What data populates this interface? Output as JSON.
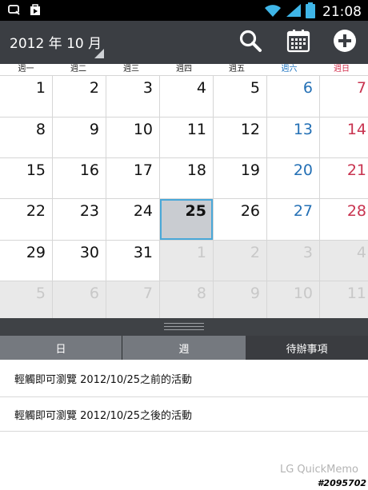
{
  "status_bar": {
    "time": "21:08",
    "icons": [
      "notification-q-icon",
      "play-store-icon",
      "wifi-icon",
      "signal-icon",
      "battery-icon"
    ]
  },
  "action_bar": {
    "month_title": "2012 年 10 月",
    "buttons": [
      "search-icon",
      "calendar-today-icon",
      "add-event-icon"
    ]
  },
  "weekdays": [
    "週一",
    "週二",
    "週三",
    "週四",
    "週五",
    "週六",
    "週日"
  ],
  "calendar": {
    "selected_day": "25",
    "weeks": [
      [
        "1",
        "2",
        "3",
        "4",
        "5",
        "6",
        "7"
      ],
      [
        "8",
        "9",
        "10",
        "11",
        "12",
        "13",
        "14"
      ],
      [
        "15",
        "16",
        "17",
        "18",
        "19",
        "20",
        "21"
      ],
      [
        "22",
        "23",
        "24",
        "25",
        "26",
        "27",
        "28"
      ],
      [
        "29",
        "30",
        "31",
        "1",
        "2",
        "3",
        "4"
      ],
      [
        "5",
        "6",
        "7",
        "8",
        "9",
        "10",
        "11"
      ]
    ]
  },
  "view_tabs": [
    "日",
    "週",
    "待辦事項"
  ],
  "events": [
    "輕觸即可瀏覽 2012/10/25之前的活動",
    "輕觸即可瀏覽 2012/10/25之後的活動"
  ],
  "watermark": "LG QuickMemo",
  "stamp": "#2095702",
  "colors": {
    "saturday": "#2470b5",
    "sunday": "#c8334f",
    "selection_border": "#4aa8d8",
    "action_bar": "#3b3e43"
  }
}
